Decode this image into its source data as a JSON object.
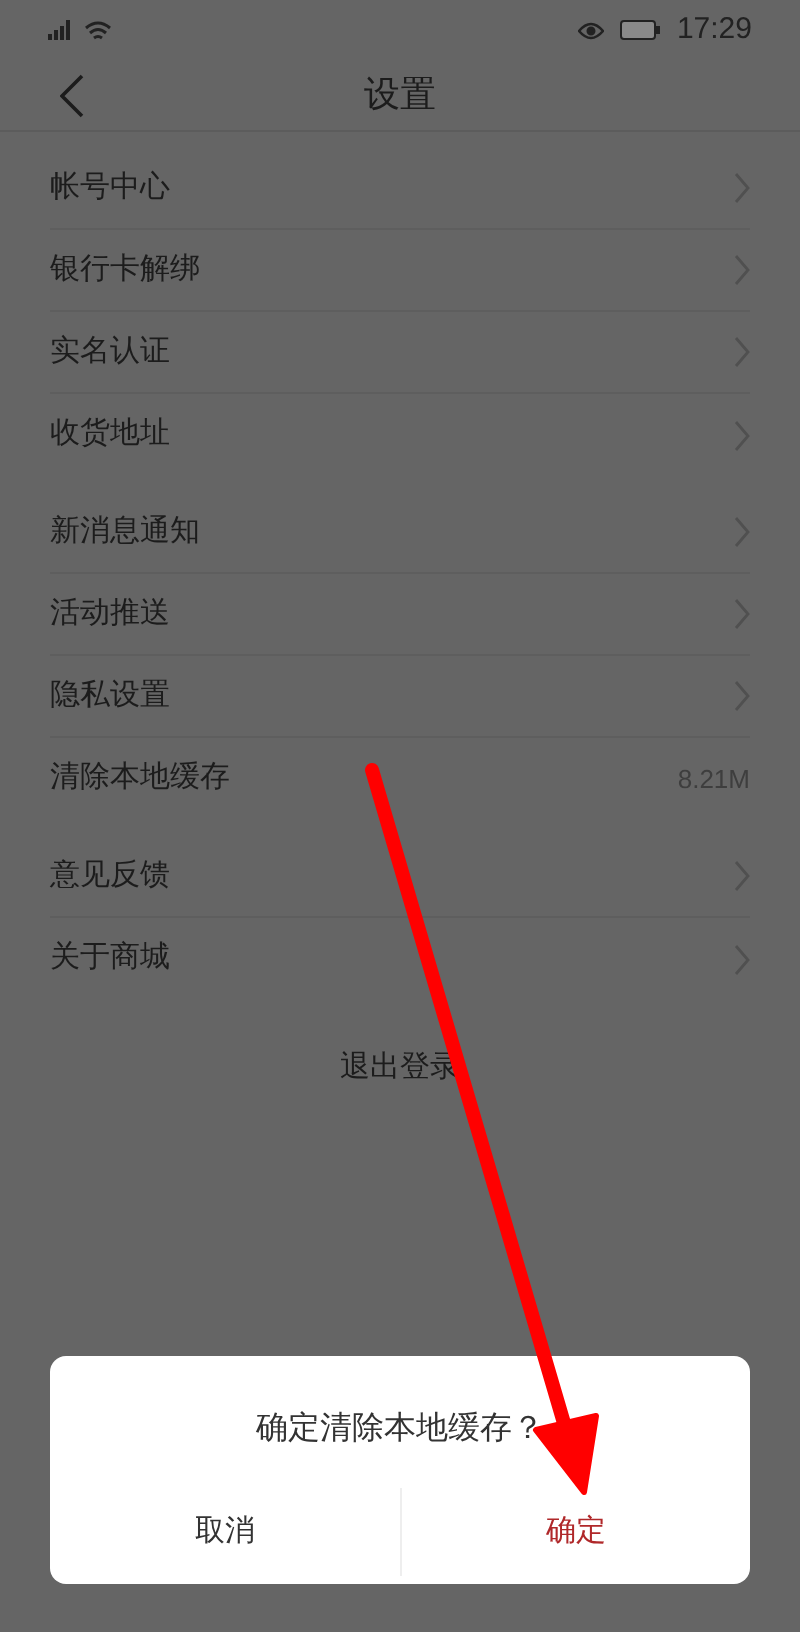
{
  "status_bar": {
    "time": "17:29"
  },
  "header": {
    "title": "设置"
  },
  "groups": [
    {
      "items": [
        {
          "label": "帐号中心",
          "kind": "link"
        },
        {
          "label": "银行卡解绑",
          "kind": "link"
        },
        {
          "label": "实名认证",
          "kind": "link"
        },
        {
          "label": "收货地址",
          "kind": "link"
        }
      ]
    },
    {
      "items": [
        {
          "label": "新消息通知",
          "kind": "link"
        },
        {
          "label": "活动推送",
          "kind": "link"
        },
        {
          "label": "隐私设置",
          "kind": "link"
        },
        {
          "label": "清除本地缓存",
          "kind": "value",
          "value": "8.21M"
        }
      ]
    },
    {
      "items": [
        {
          "label": "意见反馈",
          "kind": "link"
        },
        {
          "label": "关于商城",
          "kind": "link"
        }
      ]
    }
  ],
  "logout": {
    "label": "退出登录"
  },
  "dialog": {
    "message": "确定清除本地缓存？",
    "buttons": [
      {
        "label": "取消",
        "kind": "cancel"
      },
      {
        "label": "确定",
        "kind": "confirm"
      }
    ]
  }
}
